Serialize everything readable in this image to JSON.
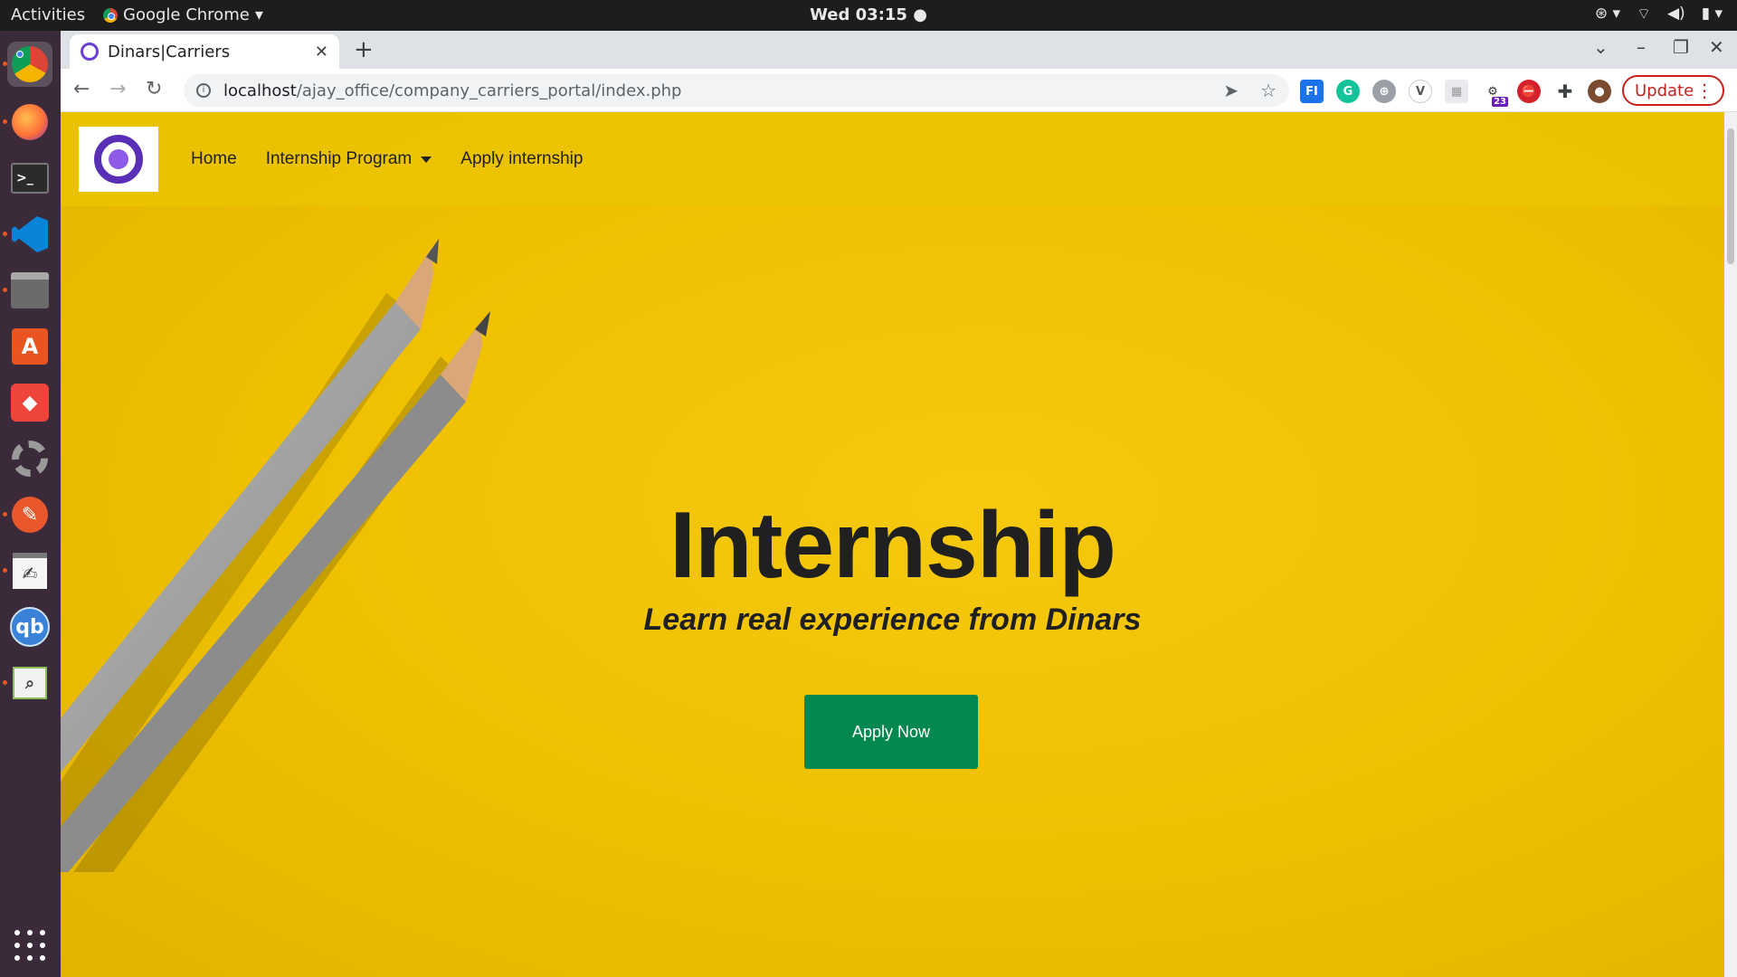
{
  "topbar": {
    "activities": "Activities",
    "app_name": "Google Chrome",
    "clock": "Wed 03:15 ●"
  },
  "browser": {
    "tab_title": "Dinars|Carriers",
    "url_host": "localhost",
    "url_path": "/ajay_office/company_carriers_portal/index.php",
    "update_label": "Update",
    "extension_badge": "23"
  },
  "site": {
    "nav": {
      "home": "Home",
      "internship_program": "Internship Program",
      "apply_internship": "Apply internship"
    },
    "hero": {
      "title": "Internship",
      "subtitle": "Learn real experience from Dinars",
      "cta": "Apply Now"
    }
  },
  "colors": {
    "hero_background": "#eec000",
    "cta_background": "#03884f",
    "update_accent": "#c5221f",
    "logo_purple": "#5a2fb8"
  },
  "dock_icons": [
    "chrome-icon",
    "firefox-icon",
    "terminal-icon",
    "vscode-icon",
    "files-icon",
    "software-center-icon",
    "anydesk-icon",
    "settings-icon",
    "pen-tool-icon",
    "text-editor-icon",
    "qbittorrent-icon",
    "image-viewer-icon",
    "show-applications-icon"
  ]
}
